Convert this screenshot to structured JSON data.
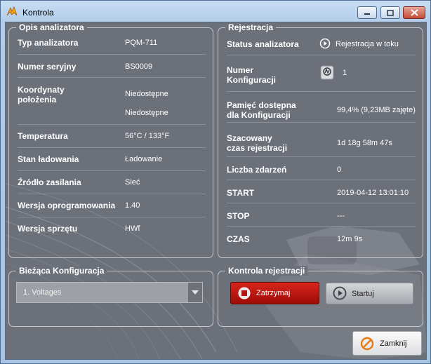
{
  "window": {
    "title": "Kontrola"
  },
  "analyzer_group": {
    "title": "Opis analizatora",
    "rows": [
      {
        "label": "Typ analizatora",
        "value": "PQM-711"
      },
      {
        "label": "Numer seryjny",
        "value": "BS0009"
      },
      {
        "label": "Koordynaty położenia",
        "value": "Niedostępne",
        "value2": "Niedostępne"
      },
      {
        "label": "Temperatura",
        "value": "56°C / 133°F"
      },
      {
        "label": "Stan ładowania",
        "value": "Ładowanie"
      },
      {
        "label": "Źródło zasilania",
        "value": "Sieć"
      },
      {
        "label": "Wersja oprogramowania",
        "value": "1.40"
      },
      {
        "label": "Wersja sprzętu",
        "value": "HWf"
      }
    ]
  },
  "recording_group": {
    "title": "Rejestracja",
    "rows": [
      {
        "label": "Status analizatora",
        "value": "Rejestracja w toku",
        "icon": "play-circle-icon"
      },
      {
        "label": "Numer Konfiguracji",
        "value": "1",
        "icon": "config-icon"
      },
      {
        "label": "Pamięć dostępna dla Konfiguracji",
        "value": "99,4% (9,23MB zajęte)"
      },
      {
        "label": "Szacowany czas rejestracji",
        "value": "1d 18g 58m 47s"
      },
      {
        "label": "Liczba zdarzeń",
        "value": "0"
      },
      {
        "label": "START",
        "value": "2019-04-12 13:01:10"
      },
      {
        "label": "STOP",
        "value": "---"
      },
      {
        "label": "CZAS",
        "value": "12m 9s"
      }
    ]
  },
  "config_group": {
    "title": "Bieżąca Konfiguracja",
    "selected": "1. Voltages"
  },
  "control_group": {
    "title": "Kontrola rejestracji",
    "stop_label": "Zatrzymaj",
    "start_label": "Startuj"
  },
  "close_label": "Zamknij"
}
